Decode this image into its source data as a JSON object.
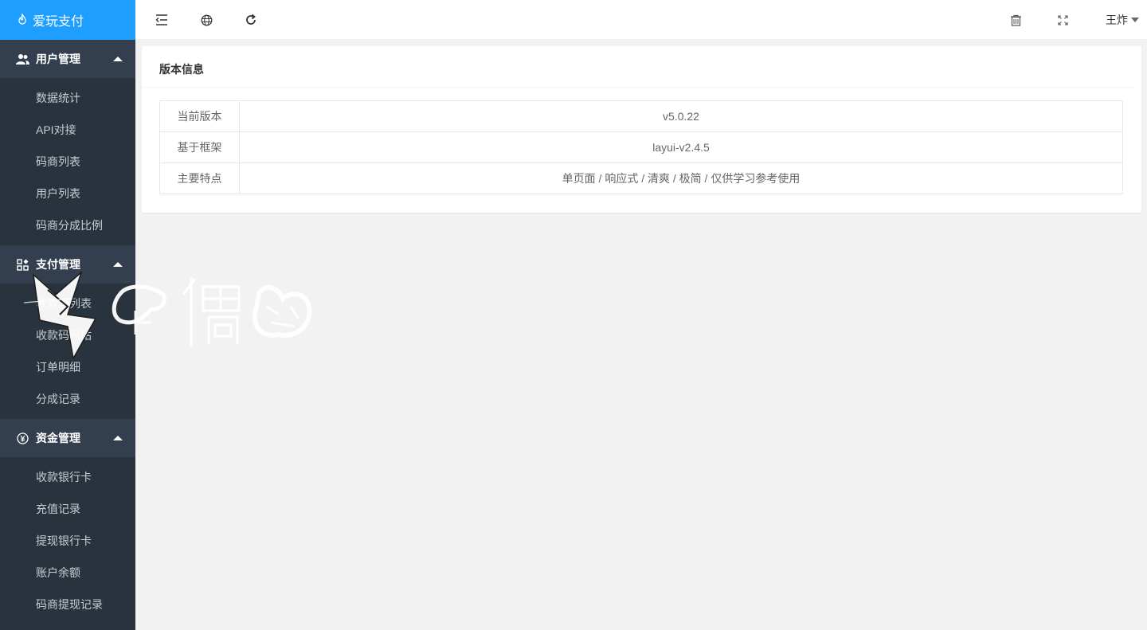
{
  "app": {
    "logo_text": "爱玩支付",
    "logo_icon": "fire-icon"
  },
  "sidebar": {
    "groups": [
      {
        "title": "用户管理",
        "icon": "users-icon",
        "items": [
          "数据统计",
          "API对接",
          "码商列表",
          "用户列表",
          "码商分成比例"
        ]
      },
      {
        "title": "支付管理",
        "icon": "apps-icon",
        "items": [
          "收款码列表",
          "收款码网站",
          "订单明细",
          "分成记录"
        ]
      },
      {
        "title": "资金管理",
        "icon": "yen-icon",
        "items": [
          "收款银行卡",
          "充值记录",
          "提现银行卡",
          "账户余额",
          "码商提现记录"
        ]
      }
    ]
  },
  "topbar": {
    "icons": [
      "menu-collapse-icon",
      "globe-icon",
      "refresh-icon"
    ],
    "right_icons": [
      "trash-icon",
      "fullscreen-icon"
    ],
    "username": "王炸"
  },
  "main": {
    "card_title": "版本信息",
    "rows": [
      {
        "key": "当前版本",
        "value": "v5.0.22"
      },
      {
        "key": "基于框架",
        "value": "layui-v2.4.5"
      },
      {
        "key": "主要特点",
        "value": "单页面 / 响应式 / 清爽 / 极简 / 仅供学习参考使用"
      }
    ]
  },
  "watermark": {
    "text": "偶猫"
  },
  "colors": {
    "sidebar_bg": "#28333e",
    "group_bg": "#333f4e",
    "logo_bg": "#1e9fff",
    "page_bg": "#f2f2f2"
  }
}
